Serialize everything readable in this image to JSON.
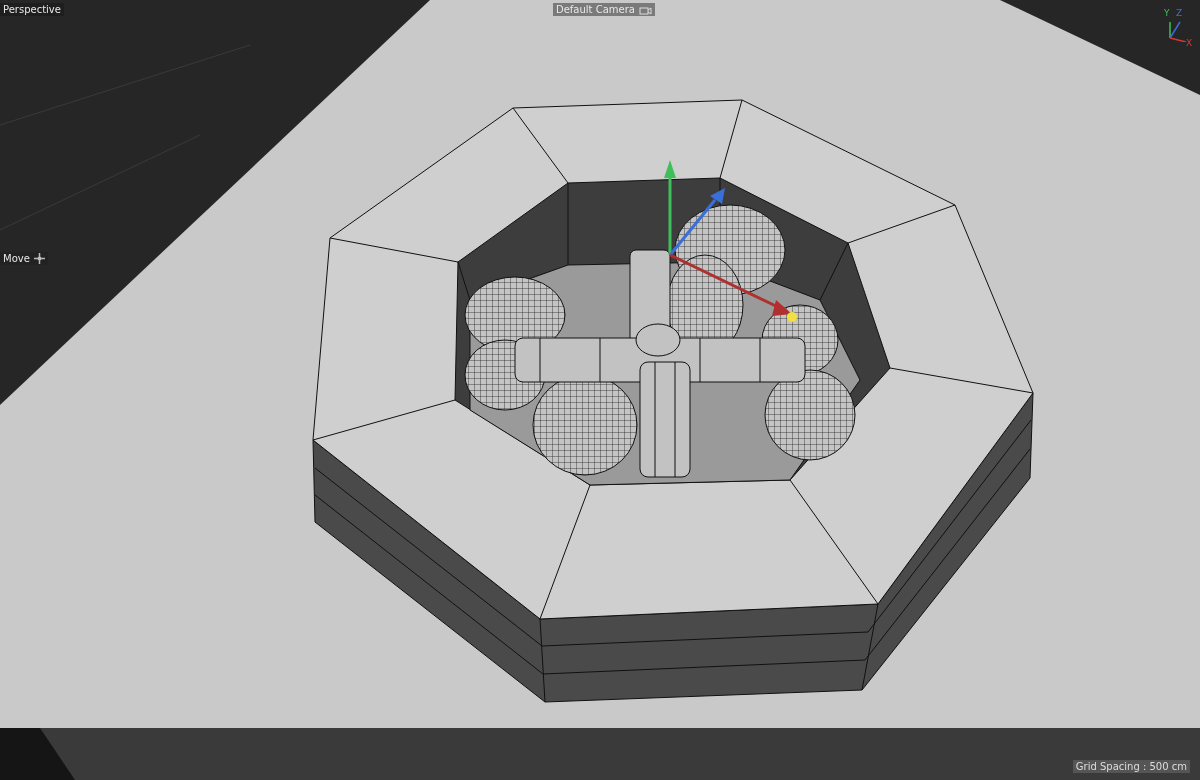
{
  "viewport": {
    "view_name": "Perspective",
    "camera": "Default Camera",
    "axis_labels": [
      "Y",
      "Z",
      "X"
    ],
    "tool": "Move",
    "grid_spacing": "Grid Spacing : 500 cm"
  }
}
